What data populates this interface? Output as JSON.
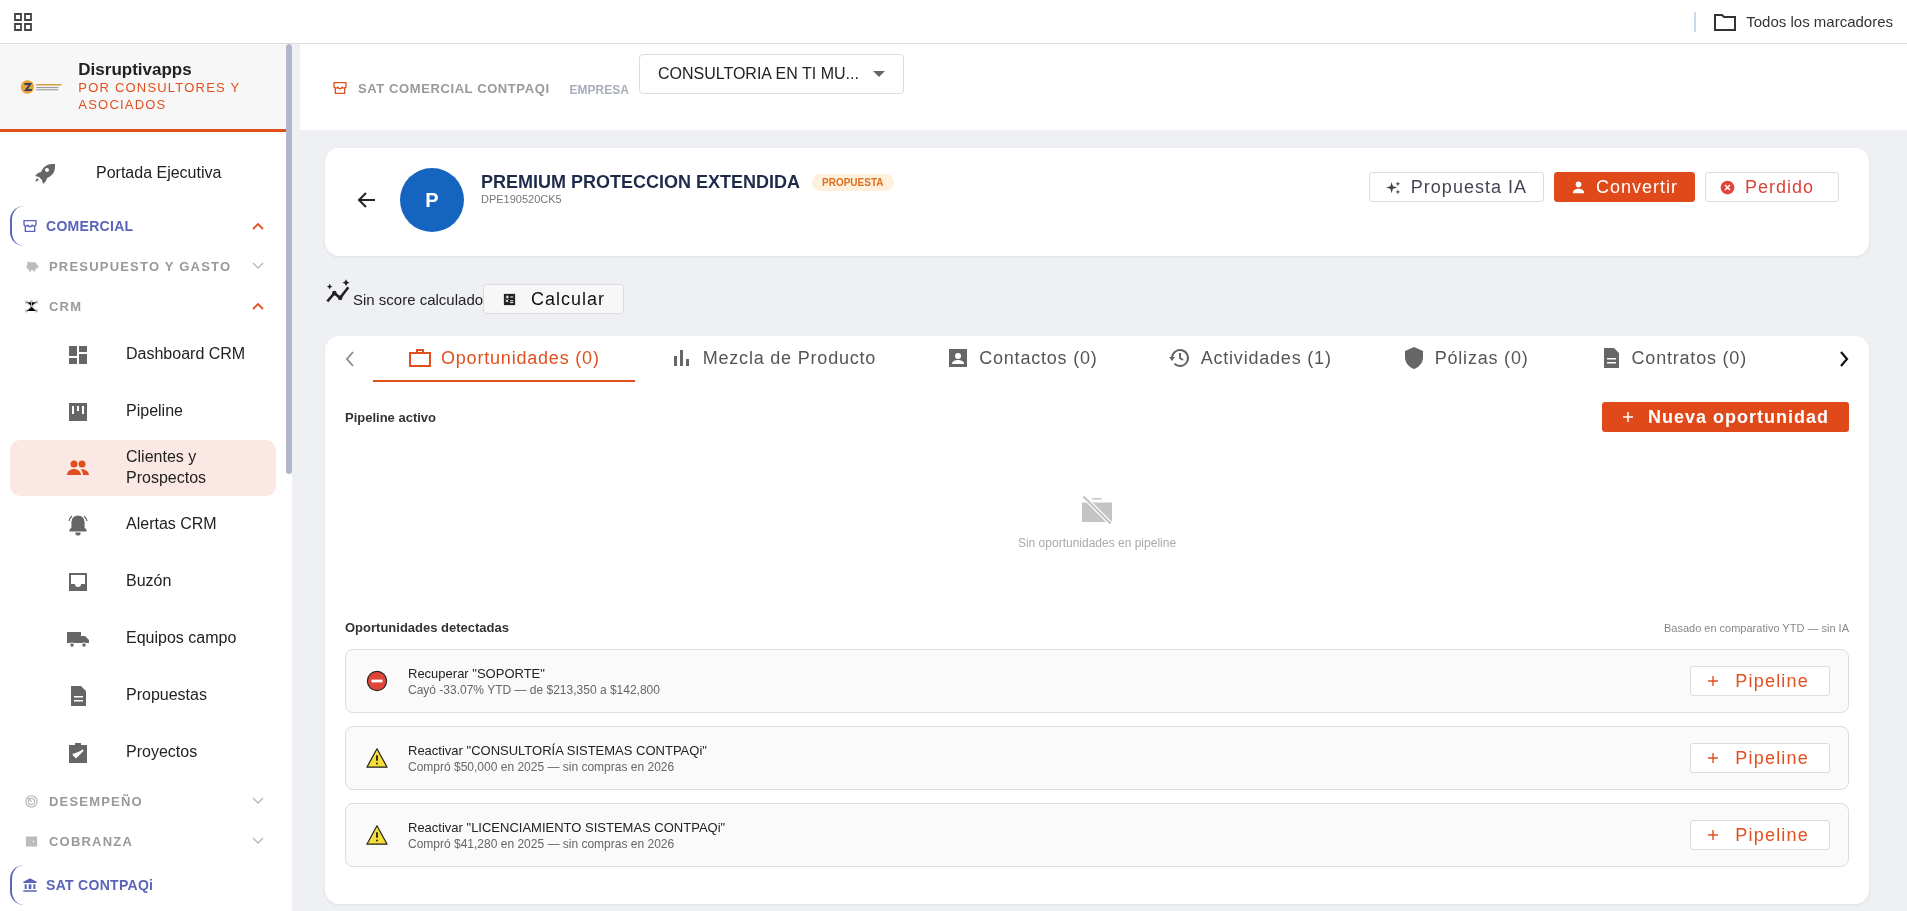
{
  "browser_bar": {
    "bookmarks_label": "Todos los marcadores"
  },
  "sidebar": {
    "brand": {
      "name": "Disruptivapps",
      "tagline": "POR CONSULTORES Y ASOCIADOS"
    },
    "items": [
      {
        "kind": "link",
        "label": "Portada Ejecutiva"
      },
      {
        "kind": "section",
        "label": "COMERCIAL",
        "expanded": true,
        "children": [
          {
            "kind": "group",
            "label": "PRESUPUESTO Y GASTO",
            "expanded": false
          },
          {
            "kind": "group",
            "label": "CRM",
            "expanded": true,
            "children": [
              {
                "label": "Dashboard CRM",
                "selected": false
              },
              {
                "label": "Pipeline",
                "selected": false
              },
              {
                "label": "Clientes y Prospectos",
                "selected": true
              },
              {
                "label": "Alertas CRM",
                "selected": false
              },
              {
                "label": "Buzón",
                "selected": false
              },
              {
                "label": "Equipos campo",
                "selected": false
              },
              {
                "label": "Propuestas",
                "selected": false
              },
              {
                "label": "Proyectos",
                "selected": false
              }
            ]
          },
          {
            "kind": "group",
            "label": "DESEMPEÑO",
            "expanded": false
          },
          {
            "kind": "group",
            "label": "COBRANZA",
            "expanded": false
          }
        ]
      },
      {
        "kind": "section",
        "label": "SAT CONTPAQi"
      }
    ]
  },
  "header": {
    "module": "SAT COMERCIAL CONTPAQI",
    "company_label": "EMPRESA",
    "company_value": "CONSULTORIA EN TI MU..."
  },
  "record": {
    "avatar": "P",
    "name": "PREMIUM PROTECCION EXTENDIDA",
    "code": "DPE190520CK5",
    "badge": "PROPUESTA",
    "actions": [
      {
        "kind": "outline",
        "label": "Propuesta IA"
      },
      {
        "kind": "primary",
        "label": "Convertir"
      },
      {
        "kind": "danger",
        "label": "Perdido"
      }
    ]
  },
  "score": {
    "text": "Sin score calculado",
    "button": "Calcular"
  },
  "tabs": [
    {
      "label": "Oportunidades (0)",
      "selected": true
    },
    {
      "label": "Mezcla de Producto",
      "selected": false
    },
    {
      "label": "Contactos (0)",
      "selected": false
    },
    {
      "label": "Actividades (1)",
      "selected": false
    },
    {
      "label": "Pólizas (0)",
      "selected": false
    },
    {
      "label": "Contratos (0)",
      "selected": false
    }
  ],
  "pipeline": {
    "title": "Pipeline activo",
    "new_button": "Nueva oportunidad",
    "empty_text": "Sin oportunidades en pipeline"
  },
  "detected": {
    "title": "Oportunidades detectadas",
    "note": "Basado en comparativo YTD — sin IA",
    "rows": [
      {
        "kind": "error",
        "title": "Recuperar \"SOPORTE\"",
        "detail": "Cayó -33.07% YTD — de $213,350 a $142,800",
        "button": "Pipeline"
      },
      {
        "kind": "warning",
        "title": "Reactivar \"CONSULTORÍA SISTEMAS CONTPAQi\"",
        "detail": "Compró $50,000 en 2025 — sin compras en 2026",
        "button": "Pipeline"
      },
      {
        "kind": "warning",
        "title": "Reactivar \"LICENCIAMIENTO SISTEMAS CONTPAQi\"",
        "detail": "Compró $41,280 en 2025 — sin compras en 2026",
        "button": "Pipeline"
      }
    ]
  }
}
